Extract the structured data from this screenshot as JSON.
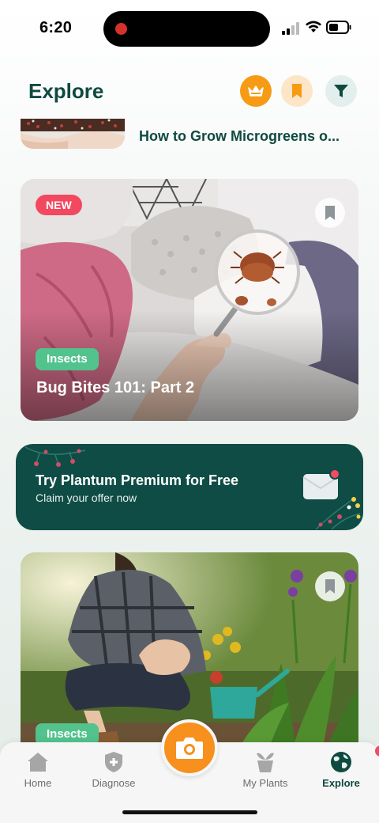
{
  "status_bar": {
    "time": "6:20"
  },
  "header": {
    "title": "Explore"
  },
  "mini_article": {
    "title": "How to Grow Microgreens o..."
  },
  "cards": [
    {
      "badge": "NEW",
      "tag": "Insects",
      "title": "Bug Bites 101: Part 2"
    },
    {
      "tag": "Insects"
    }
  ],
  "promo": {
    "title": "Try Plantum Premium for Free",
    "subtitle": "Claim your offer now"
  },
  "nav": [
    {
      "label": "Home",
      "icon": "home-icon"
    },
    {
      "label": "Diagnose",
      "icon": "shield-plus-icon"
    },
    {
      "label": "My Plants",
      "icon": "plant-pot-icon"
    },
    {
      "label": "Explore",
      "icon": "globe-icon",
      "active": true
    }
  ],
  "colors": {
    "brand_green": "#0e4c45",
    "accent_orange": "#f79a14",
    "tag_green": "#52c38c",
    "badge_red": "#f24860"
  }
}
